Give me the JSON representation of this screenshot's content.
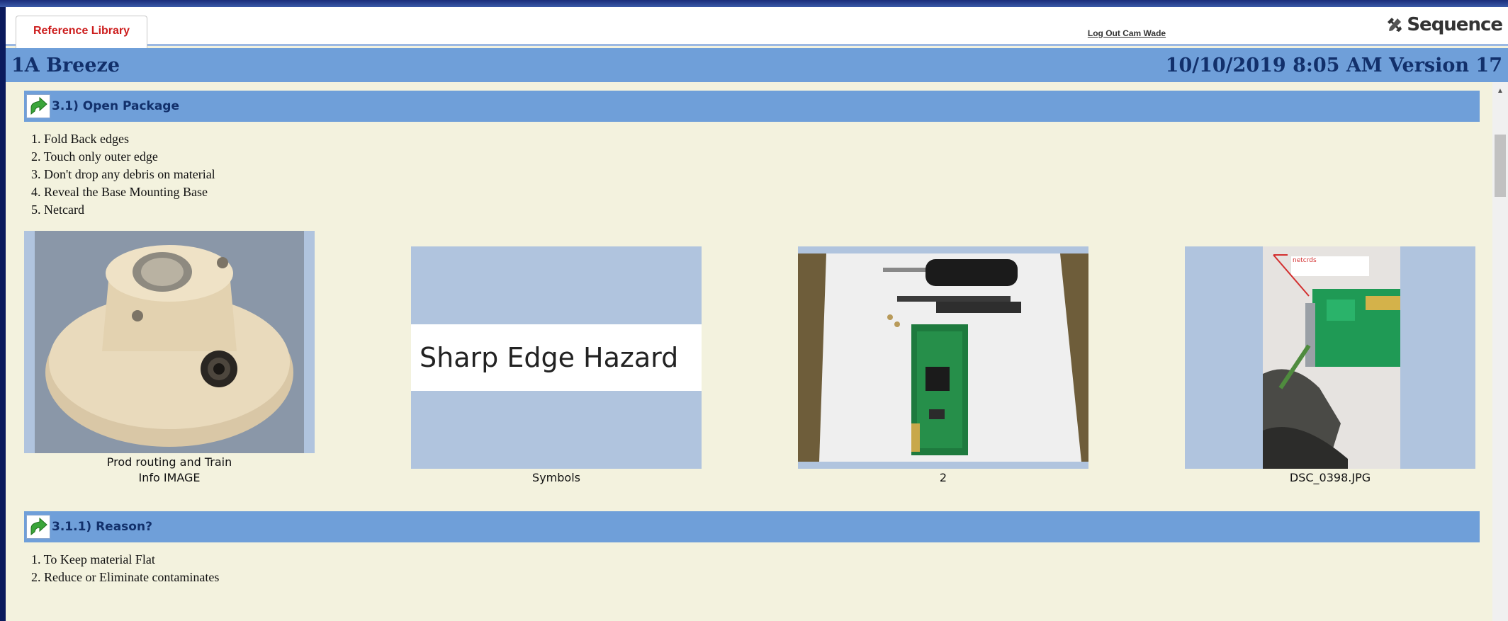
{
  "header": {
    "tab_label": "Reference Library",
    "logout_label": "Log Out Cam Wade",
    "brand": "Sequence",
    "brand_icon": "tools-icon"
  },
  "titlebar": {
    "title": "1A Breeze",
    "timestamp_version": "10/10/2019 8:05 AM Version 17"
  },
  "sections": [
    {
      "title": "3.1) Open Package",
      "steps": [
        "1. Fold Back edges",
        "2. Touch only outer edge",
        "3. Don't drop any debris on material",
        "4. Reveal the Base Mounting Base",
        "5. Netcard"
      ],
      "images": [
        {
          "caption": "Prod routing and Train Info IMAGE",
          "caption_line1": "Prod routing and Train",
          "caption_line2": "Info IMAGE",
          "depicts": "mounting-base-photo"
        },
        {
          "caption": "Symbols",
          "depicts": "hazard-symbol",
          "text": "Sharp Edge Hazard"
        },
        {
          "caption": "2",
          "depicts": "netcard-and-screwdriver-photo"
        },
        {
          "caption": "DSC_0398.JPG",
          "depicts": "netcard-install-photo",
          "note_label": "netcrds"
        }
      ]
    },
    {
      "title": "3.1.1) Reason?",
      "steps": [
        "1. To Keep material Flat",
        "2. Reduce or Eliminate contaminates"
      ]
    }
  ],
  "colors": {
    "section_blue": "#6f9fd9",
    "title_text": "#12306b",
    "tab_text": "#cc1c1c",
    "content_bg": "#f3f2de",
    "frame_bg": "#b0c4de"
  }
}
